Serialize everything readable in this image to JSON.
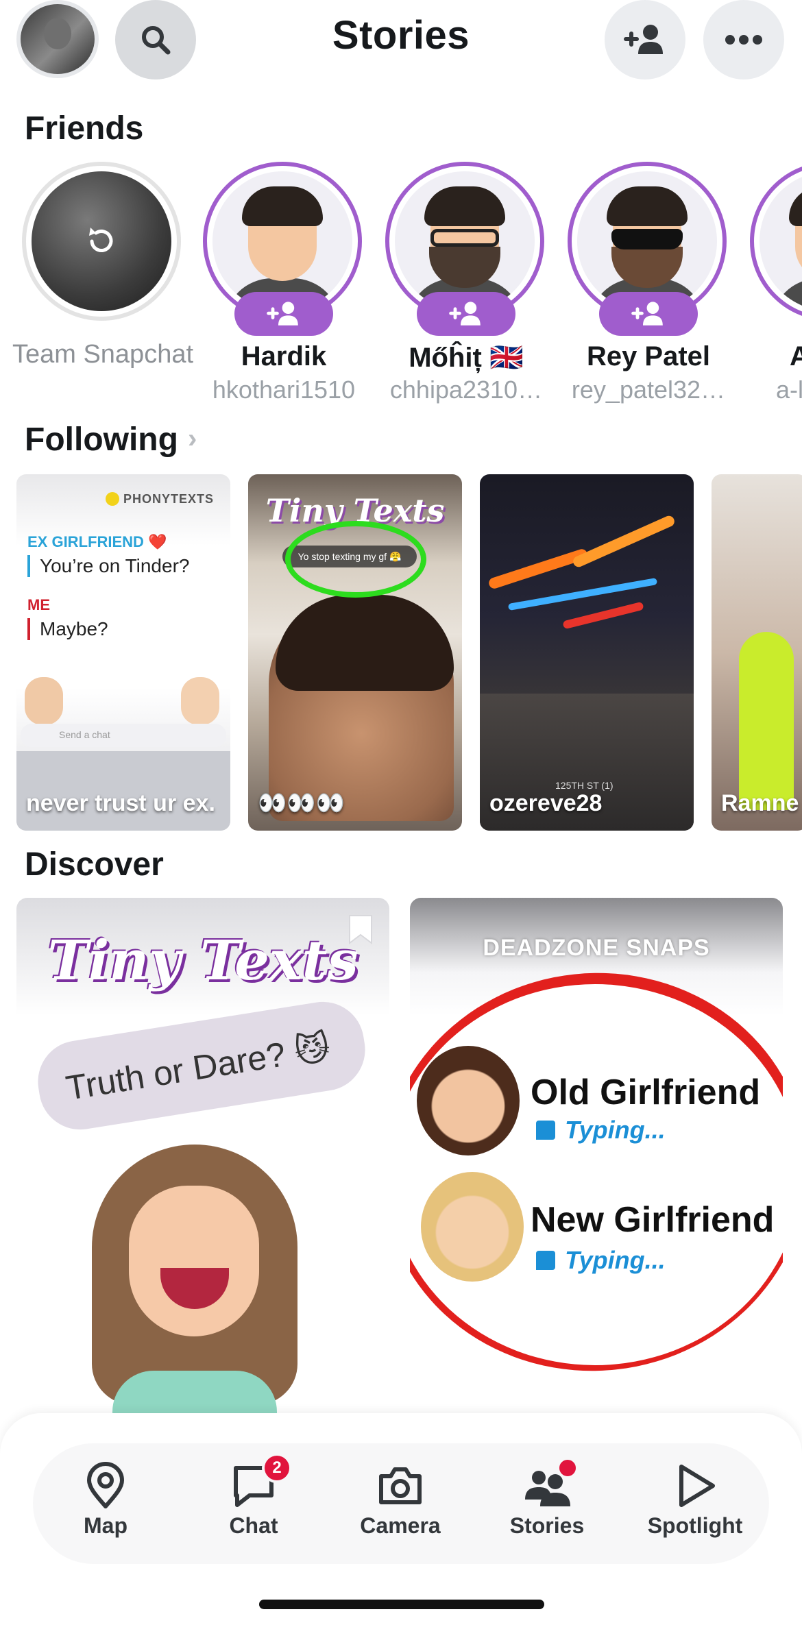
{
  "header": {
    "title": "Stories"
  },
  "friends": {
    "section_title": "Friends",
    "items": [
      {
        "name": "Team Snapchat",
        "username": ""
      },
      {
        "name": "Hardik",
        "username": "hkothari1510"
      },
      {
        "name": "Mőĥiț 🇬🇧",
        "username": "chhipa2310…"
      },
      {
        "name": "Rey Patel",
        "username": "rey_patel32…"
      },
      {
        "name": "A",
        "username": "a-l"
      }
    ]
  },
  "following": {
    "section_title": "Following",
    "cards": [
      {
        "name": "never trust ur ex.",
        "brand": "PHONYTEXTS",
        "label_1": "EX GIRLFRIEND ❤️",
        "text_1": "You’re on Tinder?",
        "label_2": "ME",
        "text_2": "Maybe?",
        "chat_placeholder": "Send a chat"
      },
      {
        "name": "👀👀👀",
        "logo": "Tiny Texts",
        "bubble": "Yo stop texting my gf 😤"
      },
      {
        "name": "ozereve28",
        "street_sign": "125TH ST (1)"
      },
      {
        "name": "Ramne"
      }
    ]
  },
  "discover": {
    "section_title": "Discover",
    "cards": [
      {
        "logo": "Tiny Texts",
        "bubble": "Truth or Dare? 😼"
      },
      {
        "brand": "DEADZONE SNAPS",
        "row_1_title": "Old Girlfriend",
        "row_1_status": "Typing...",
        "row_2_title": "New Girlfriend",
        "row_2_status": "Typing..."
      }
    ]
  },
  "nav": {
    "items": [
      {
        "label": "Map"
      },
      {
        "label": "Chat",
        "badge": "2"
      },
      {
        "label": "Camera"
      },
      {
        "label": "Stories"
      },
      {
        "label": "Spotlight"
      }
    ]
  },
  "colors": {
    "accent_purple": "#a05dcd",
    "badge_red": "#e1143d",
    "typing_blue": "#1b8fd6"
  }
}
